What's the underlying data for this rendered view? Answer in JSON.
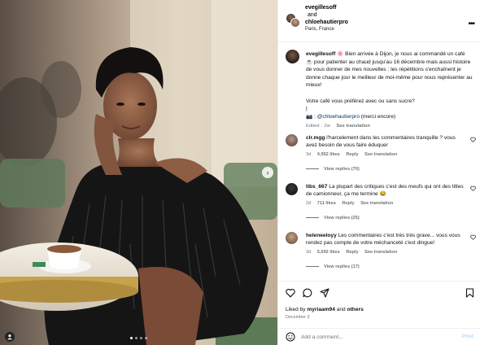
{
  "header": {
    "user1": "evegillesoff",
    "and": "and",
    "user2": "chloehautierpro",
    "location": "Paris, France",
    "more_icon": "more-horizontal-icon"
  },
  "caption": {
    "username": "evegillesoff",
    "text1": "🌸 Bien arrivée à Dijon, je nous ai commandé un café ☕ pour patienter au chaud jusqu'au 16 décembre mais aussi histoire de vous donner de mes nouvelles : les répétitions s'enchaînent je donne chaque jour le meilleur de moi-même pour nous représenter au mieux!",
    "text2": "Votre café vous préférez avec ou sans sucre?",
    "camera": "📷 :",
    "mention": "@chloehautierpro",
    "thanks": "(merci encore)",
    "edited": "Edited",
    "age": "2w",
    "see_translation": "See translation"
  },
  "comments": [
    {
      "username": "clr.mgg",
      "text": "l'harcelement dans les commentaires tranquille ? vous avez besoin de vous faire éduquer",
      "age": "3d",
      "likes": "4,952 likes",
      "reply": "Reply",
      "see_translation": "See translation",
      "view_replies": "View replies (70)"
    },
    {
      "username": "tibs_667",
      "text": "La plupart des critiques c'est des meufs qui ont des tittes de camionneur, ça me termine 😂",
      "age": "2d",
      "likes": "711 likes",
      "reply": "Reply",
      "see_translation": "See translation",
      "view_replies": "View replies (25)"
    },
    {
      "username": "heleneeloyy",
      "text": "Les commentaires c'est très très grave... vous vous rendez pas compte de votre méchanceté c'est dingue!",
      "age": "3d",
      "likes": "5,692 likes",
      "reply": "Reply",
      "see_translation": "See translation",
      "view_replies": "View replies (17)"
    }
  ],
  "actions": {
    "liked_by_prefix": "Liked by",
    "liked_by_user": "myriaam94",
    "liked_by_and": "and",
    "liked_by_others": "others",
    "date": "December 3",
    "comment_placeholder": "Add a comment...",
    "post_label": "Post"
  },
  "photo": {
    "carousel_count": 4,
    "carousel_active": 0
  },
  "colors": {
    "link": "#00376b",
    "muted": "#737373",
    "post_disabled": "#b3dbff",
    "divider": "#efefef"
  }
}
